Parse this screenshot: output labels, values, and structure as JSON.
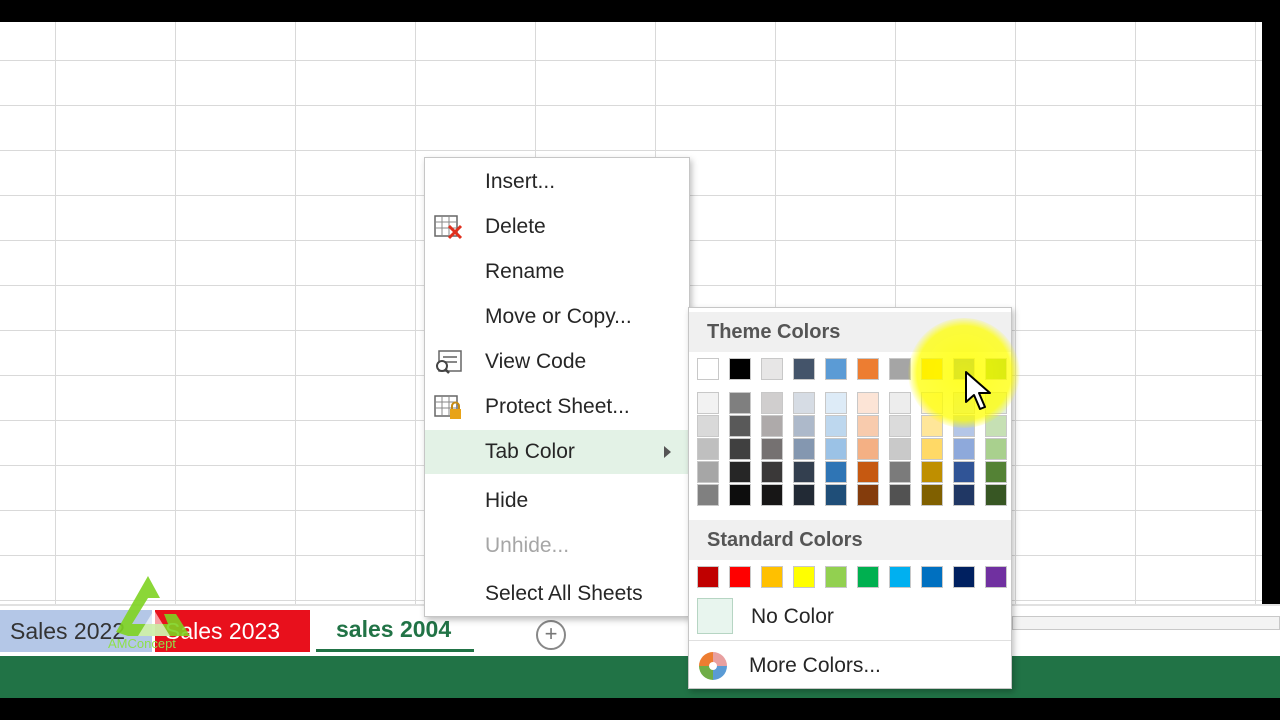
{
  "context_menu": {
    "items": [
      {
        "label": "Insert...",
        "icon": "none",
        "disabled": false
      },
      {
        "label": "Delete",
        "icon": "delete-sheet-icon",
        "disabled": false
      },
      {
        "label": "Rename",
        "icon": "none",
        "disabled": false
      },
      {
        "label": "Move or Copy...",
        "icon": "none",
        "disabled": false
      },
      {
        "label": "View Code",
        "icon": "view-code-icon",
        "disabled": false
      },
      {
        "label": "Protect Sheet...",
        "icon": "protect-sheet-icon",
        "disabled": false
      },
      {
        "label": "Tab Color",
        "icon": "none",
        "disabled": false,
        "highlighted": true,
        "has_submenu": true
      },
      {
        "label": "Hide",
        "icon": "none",
        "disabled": false
      },
      {
        "label": "Unhide...",
        "icon": "none",
        "disabled": true
      },
      {
        "label": "Select All Sheets",
        "icon": "none",
        "disabled": false
      }
    ]
  },
  "color_panel": {
    "theme_header": "Theme Colors",
    "standard_header": "Standard Colors",
    "theme_top_row": [
      "#ffffff",
      "#000000",
      "#e7e6e6",
      "#44546a",
      "#5b9bd5",
      "#ed7d31",
      "#a5a5a5",
      "#ffc000",
      "#4472c4",
      "#70ad47"
    ],
    "theme_shades": [
      [
        "#f2f2f2",
        "#d9d9d9",
        "#bfbfbf",
        "#a6a6a6",
        "#808080"
      ],
      [
        "#7f7f7f",
        "#595959",
        "#404040",
        "#262626",
        "#0d0d0d"
      ],
      [
        "#d0cece",
        "#aeaaaa",
        "#757171",
        "#3a3838",
        "#171616"
      ],
      [
        "#d6dce4",
        "#adb9ca",
        "#8497b0",
        "#333f4f",
        "#222a35"
      ],
      [
        "#ddebf7",
        "#bdd7ee",
        "#9bc2e6",
        "#2f75b5",
        "#1f4e78"
      ],
      [
        "#fce4d6",
        "#f8cbad",
        "#f4b084",
        "#c65911",
        "#843c0c"
      ],
      [
        "#ededed",
        "#dbdbdb",
        "#c9c9c9",
        "#7b7b7b",
        "#525252"
      ],
      [
        "#fff2cc",
        "#ffe699",
        "#ffd966",
        "#bf8f00",
        "#806000"
      ],
      [
        "#d9e1f2",
        "#b4c6e7",
        "#8ea9db",
        "#305496",
        "#203764"
      ],
      [
        "#e2efda",
        "#c6e0b4",
        "#a9d08e",
        "#548235",
        "#375623"
      ]
    ],
    "standard_colors": [
      "#c00000",
      "#ff0000",
      "#ffc000",
      "#ffff00",
      "#92d050",
      "#00b050",
      "#00b0f0",
      "#0070c0",
      "#002060",
      "#7030a0"
    ],
    "no_color_label": "No Color",
    "more_colors_label": "More Colors..."
  },
  "tabs": [
    {
      "label": "Sales 2022",
      "color": "#b4c7e7"
    },
    {
      "label": "Sales 2023",
      "color": "#e8101c"
    },
    {
      "label": "sales 2004",
      "active": true
    }
  ],
  "add_sheet_symbol": "+",
  "logo": {
    "text": "AMConcept"
  }
}
